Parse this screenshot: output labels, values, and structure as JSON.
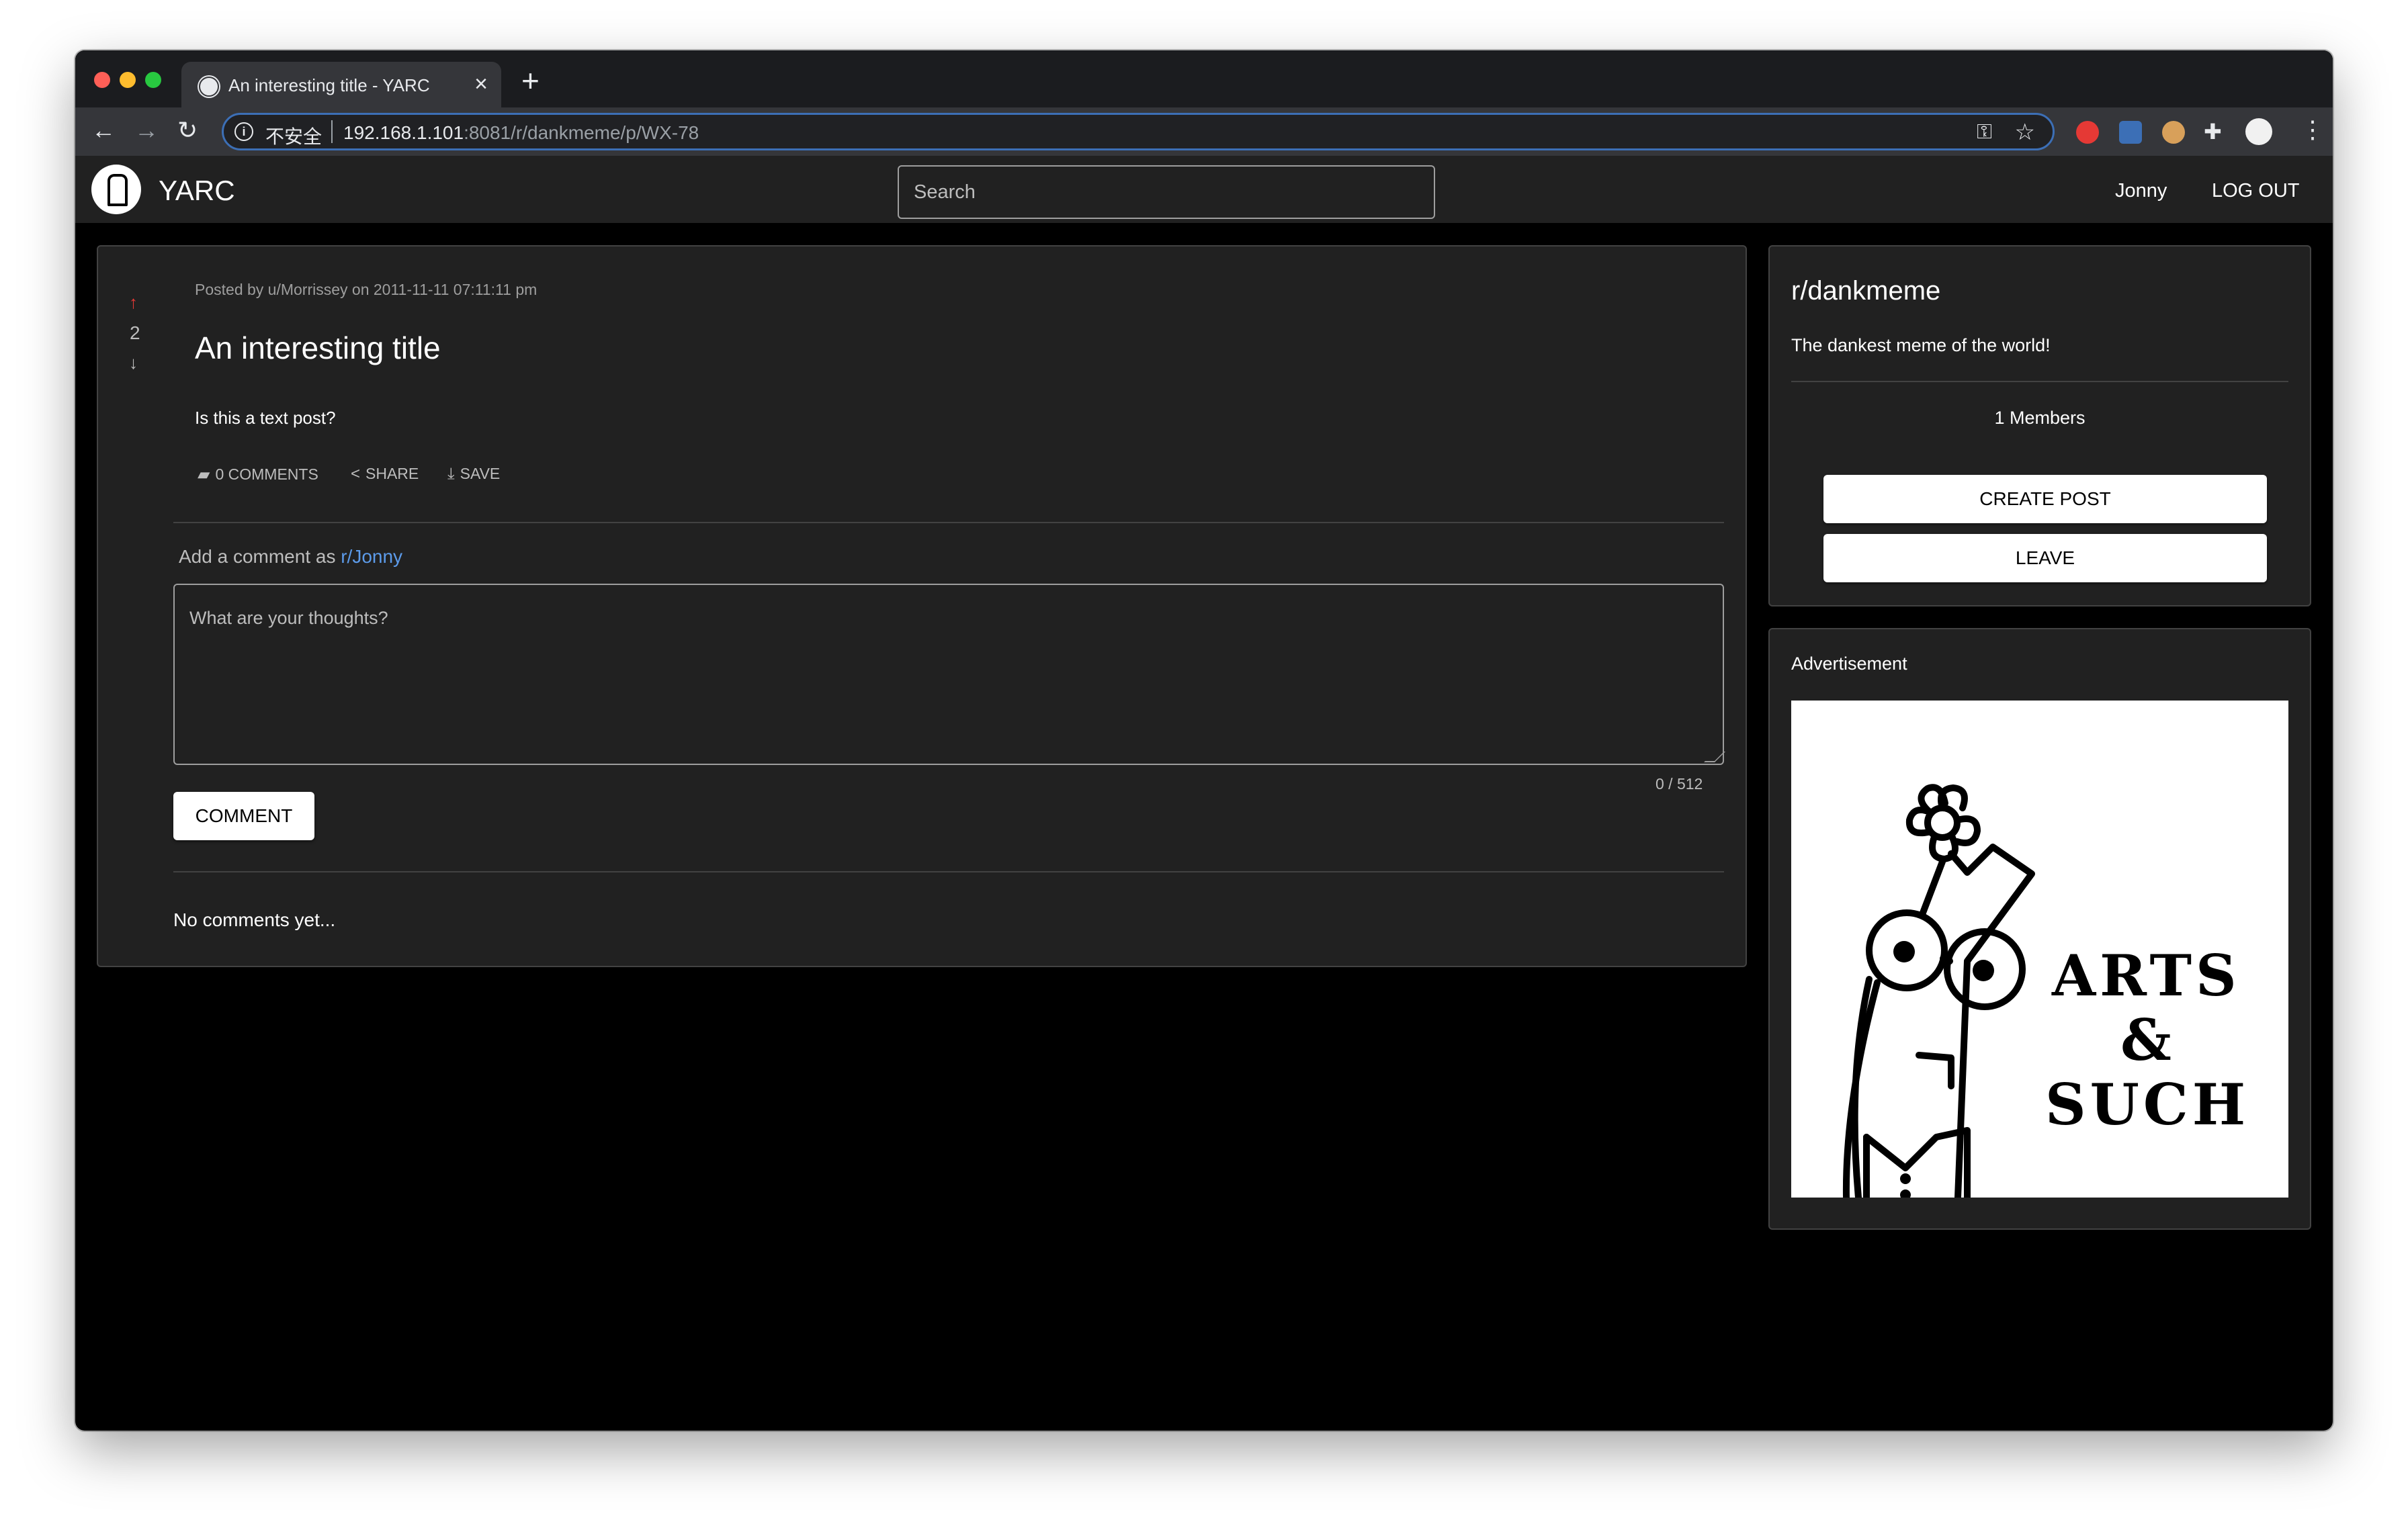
{
  "browser": {
    "tab_title": "An interesting title - YARC",
    "tab_close": "×",
    "new_tab": "+",
    "security_label": "不安全",
    "url_host": "192.168.1.101",
    "url_rest": ":8081/r/dankmeme/p/WX-78",
    "traffic_colors": [
      "#ff5f57",
      "#febc2e",
      "#28c840"
    ]
  },
  "header": {
    "brand": "YARC",
    "search_placeholder": "Search",
    "username": "Jonny",
    "logout_label": "LOG OUT"
  },
  "post": {
    "score": "2",
    "meta": "Posted by u/Morrissey on 2011-11-11 07:11:11 pm",
    "title": "An interesting title",
    "body": "Is this a text post?",
    "actions": {
      "comments": "0 COMMENTS",
      "share": "SHARE",
      "save": "SAVE"
    }
  },
  "comment_form": {
    "prompt": "Add a comment as",
    "user": "r/Jonny",
    "placeholder": "What are your thoughts?",
    "counter": "0 / 512",
    "submit_label": "COMMENT"
  },
  "comments": {
    "empty_text": "No comments yet..."
  },
  "sidebar": {
    "subreddit": "r/dankmeme",
    "description": "The dankest meme of the world!",
    "members": "1 Members",
    "create_post_label": "CREATE POST",
    "leave_label": "LEAVE"
  },
  "ad": {
    "label": "Advertisement",
    "line1": "ARTS",
    "line2": "&",
    "line3": "SUCH"
  },
  "colors": {
    "upvote": "#e53935",
    "link": "#5c9bea",
    "background": "#000000",
    "card": "#212121"
  }
}
